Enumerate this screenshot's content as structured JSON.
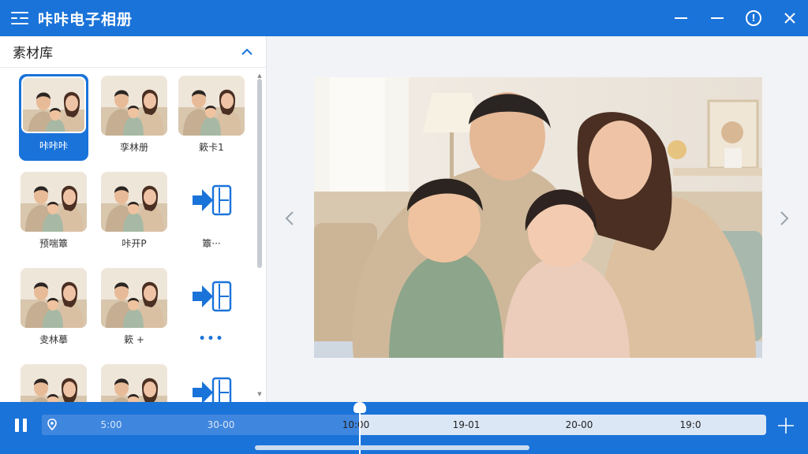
{
  "app": {
    "title": "咔咔电子相册"
  },
  "panel": {
    "title": "素材库"
  },
  "thumbnails": [
    {
      "label": "咔咔咔",
      "type": "photo",
      "selected": true
    },
    {
      "label": "孪林册",
      "type": "photo",
      "selected": false
    },
    {
      "label": "簌卡1",
      "type": "photo",
      "selected": false
    },
    {
      "label": "预喘簟",
      "type": "photo",
      "selected": false
    },
    {
      "label": "咔开P",
      "type": "photo",
      "selected": false
    },
    {
      "label": "簟···",
      "type": "import",
      "selected": false
    },
    {
      "label": "叏林摹",
      "type": "photo",
      "selected": false
    },
    {
      "label": "簌 +",
      "type": "photo",
      "selected": false
    },
    {
      "label": "•••",
      "type": "import-more",
      "selected": false
    },
    {
      "label": "",
      "type": "photo",
      "selected": false
    },
    {
      "label": "",
      "type": "photo",
      "selected": false
    },
    {
      "label": "",
      "type": "import",
      "selected": false
    }
  ],
  "timeline": {
    "ticks": [
      {
        "label": "5:00",
        "played": true
      },
      {
        "label": "30-00",
        "played": true
      },
      {
        "label": "10:00",
        "played": false
      },
      {
        "label": "19-01",
        "played": false
      },
      {
        "label": "20-00",
        "played": false
      },
      {
        "label": "19:0",
        "played": false
      }
    ]
  },
  "colors": {
    "accent": "#1a73d9",
    "track": "#dbe7f5",
    "played": "#3f86de"
  },
  "icons": {
    "app": "menu-icon",
    "minimize": "minimize-icon",
    "info": "info-icon",
    "close": "close-icon",
    "collapse": "chevron-up-icon",
    "import": "import-icon",
    "prev": "chevron-left-icon",
    "next": "chevron-right-icon",
    "pause": "pause-icon",
    "marker": "marker-icon",
    "add": "crosshair-icon"
  },
  "info_glyph": "!"
}
